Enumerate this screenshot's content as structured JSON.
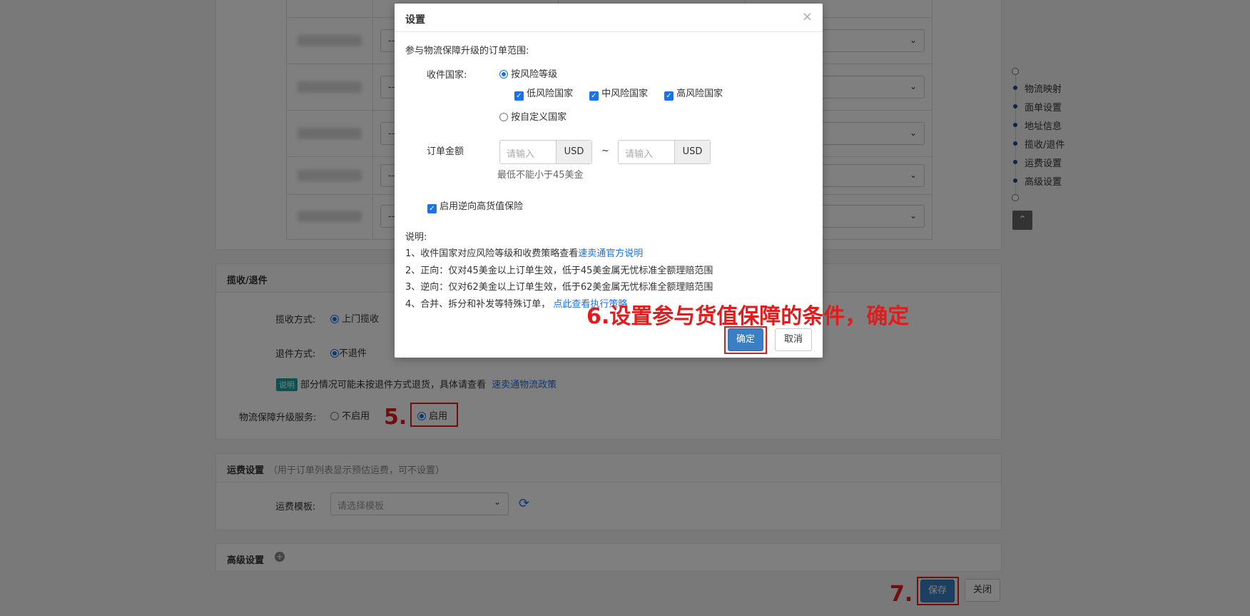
{
  "right_nav": {
    "items": [
      "物流映射",
      "面单设置",
      "地址信息",
      "揽收/退件",
      "运费设置",
      "高级设置"
    ]
  },
  "table": {
    "row_select_value": "--"
  },
  "pickup_section": {
    "title": "揽收/退件",
    "pickup_label": "揽收方式:",
    "pickup_option": "上门揽收",
    "return_label": "退件方式:",
    "return_option": "不退件",
    "note_badge": "说明",
    "note_text": "部分情况可能未按退件方式退货，具体请查看",
    "note_link": "速卖通物流政策",
    "upgrade_label": "物流保障升级服务:",
    "upgrade_off": "不启用",
    "upgrade_on": "启用"
  },
  "freight_section": {
    "title": "运费设置",
    "subtitle": "（用于订单列表显示预估运费，可不设置）",
    "template_label": "运费模板:",
    "template_placeholder": "请选择模板"
  },
  "advanced_section": {
    "title": "高级设置"
  },
  "footer": {
    "save": "保存",
    "close": "关闭"
  },
  "modal": {
    "title": "设置",
    "close_icon": "×",
    "scope_label": "参与物流保障升级的订单范围:",
    "country_label": "收件国家:",
    "by_risk": "按风险等级",
    "low_risk": "低风险国家",
    "mid_risk": "中风险国家",
    "high_risk": "高风险国家",
    "by_custom": "按自定义国家",
    "amount_label": "订单金额",
    "amount_placeholder": "请输入",
    "currency": "USD",
    "range_sep": "~",
    "amount_hint": "最低不能小于45美金",
    "reverse_insurance": "启用逆向高货值保险",
    "notes_title": "说明:",
    "note1_text": "1、收件国家对应风险等级和收费策略查看",
    "note1_link": "速卖通官方说明",
    "note2": "2、正向：仅对45美金以上订单生效，低于45美金属无忧标准全额理赔范围",
    "note3": "3、逆向：仅对62美金以上订单生效，低于62美金属无忧标准全额理赔范围",
    "note4_text": "4、合并、拆分和补发等特殊订单，",
    "note4_link": "点此查看执行策略",
    "confirm": "确定",
    "cancel": "取消"
  },
  "annotations": {
    "step5": "5.",
    "step6": "6.设置参与货值保障的条件，确定",
    "step7": "7."
  },
  "colors": {
    "primary": "#3a7fc3",
    "annotation": "#e21c1c",
    "link": "#1a73e8"
  }
}
